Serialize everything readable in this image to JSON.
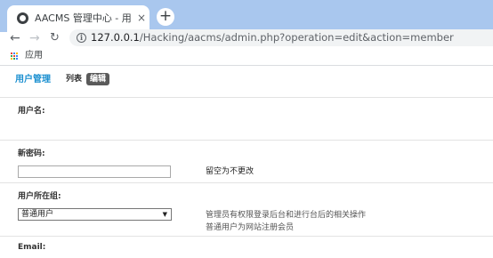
{
  "browser": {
    "tab_title": "AACMS 管理中心 - 用户 - 编辑用户",
    "tab_close": "×",
    "new_tab": "+",
    "url_host": "127.0.0.1",
    "url_path": "/Hacking/aacms/admin.php?operation=edit&action=member",
    "bookmark_apps": "应用"
  },
  "header": {
    "title": "用户管理",
    "list_link": "列表",
    "edit_badge": "编辑"
  },
  "form": {
    "username": {
      "label": "用户名:"
    },
    "password": {
      "label": "新密码:",
      "value": "",
      "hint": "留空为不更改"
    },
    "group": {
      "label": "用户所在组:",
      "selected": "普通用户",
      "hint_lines": [
        "管理员有权限登录后台和进行台后的相关操作",
        "普通用户为网站注册会员"
      ]
    },
    "email": {
      "label": "Email:"
    }
  },
  "colors": {
    "accent": "#1a8fd0",
    "badge_bg": "#5a5a5a",
    "tabbar_bg": "#a9c7ee"
  }
}
